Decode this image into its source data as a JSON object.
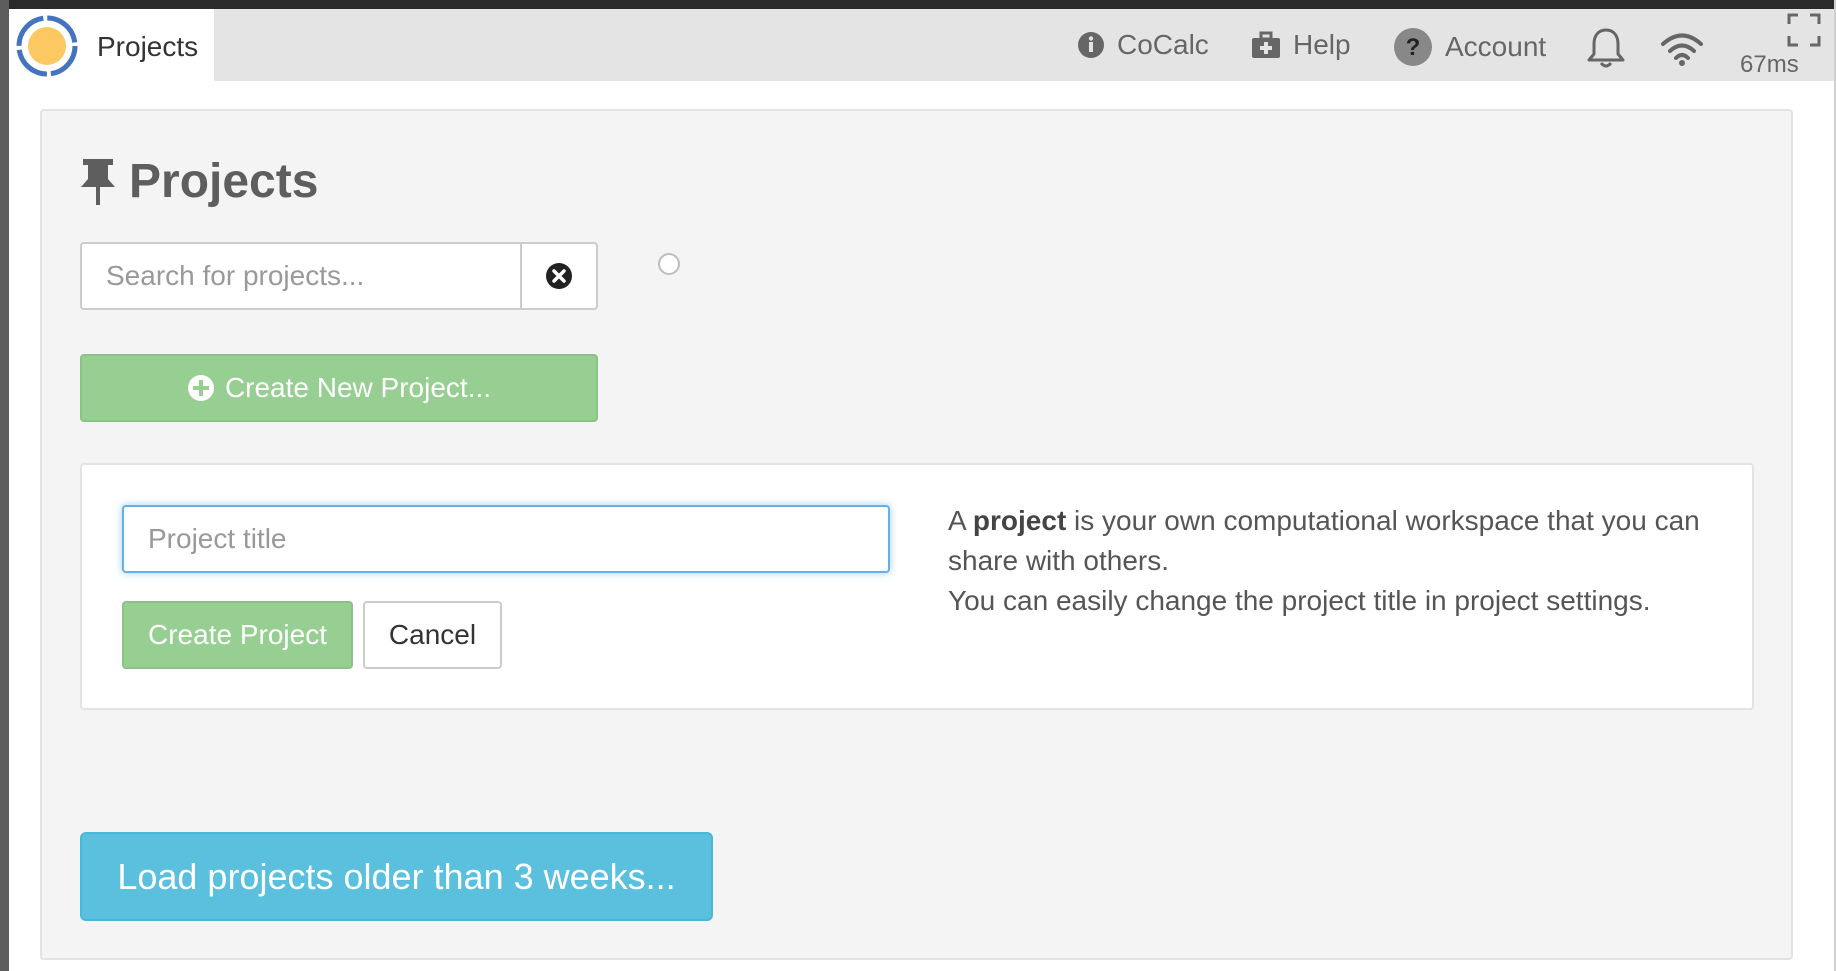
{
  "topbar": {
    "active_tab": {
      "label": "Projects",
      "icon": "cocalc-logo-icon"
    },
    "nav": {
      "cocalc": {
        "label": "CoCalc",
        "icon": "info-circle-icon"
      },
      "help": {
        "label": "Help",
        "icon": "medkit-icon"
      },
      "account": {
        "label": "Account",
        "icon": "question-circle-icon"
      },
      "notifications": {
        "icon": "bell-icon"
      },
      "connection": {
        "icon": "wifi-icon",
        "ping": "67ms"
      },
      "fullscreen": {
        "icon": "expand-icon"
      }
    }
  },
  "main": {
    "title": "Projects",
    "title_icon": "thumbtack-icon",
    "search": {
      "placeholder": "Search for projects...",
      "value": ""
    },
    "create_new_label": "Create New Project...",
    "create_form": {
      "title_placeholder": "Project title",
      "title_value": "",
      "create_label": "Create Project",
      "cancel_label": "Cancel",
      "explain_prefix": "A ",
      "explain_bold": "project",
      "explain_rest": " is your own computational workspace that you can share with others.",
      "explain_line2": "You can easily change the project title in project settings."
    },
    "load_older_label": "Load projects older than 3 weeks..."
  },
  "colors": {
    "success": "#97cf92",
    "info": "#5bc0de",
    "topbar_bg": "#e4e4e4",
    "panel_bg": "#f4f4f4",
    "focus": "#66afe9",
    "logo_orange": "#fcc861",
    "logo_blue": "#4474c0"
  }
}
